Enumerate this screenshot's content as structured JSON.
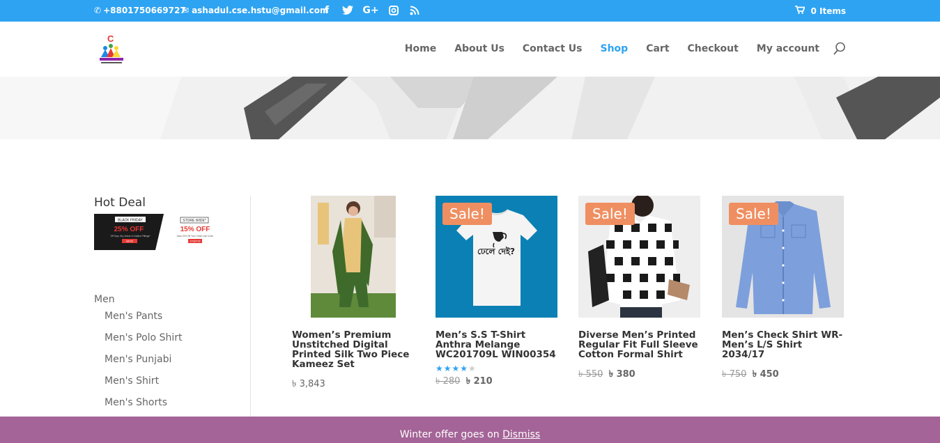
{
  "topbar": {
    "phone": "+8801750669727",
    "email": "ashadul.cse.hstu@gmail.com",
    "social": [
      "f",
      "t",
      "G+",
      "ig",
      "rss"
    ],
    "cart": "0 Items"
  },
  "nav": {
    "items": [
      "Home",
      "About Us",
      "Contact Us",
      "Shop",
      "Cart",
      "Checkout",
      "My account"
    ],
    "active": "Shop"
  },
  "sidebar": {
    "hot_deal_title": "Hot Deal",
    "deal": {
      "left_tag": "BLACK FRIDAY",
      "left_percent": "25% OFF",
      "left_note": "Off Tops, Dry, Indoor & Outdoor Fittings*",
      "left_code": "BF25",
      "right_tag": "STORE WIDE*",
      "right_percent": "15% OFF",
      "right_note": "Save 15% Off Your Order! Use Code:",
      "right_code": "XTEP15"
    },
    "category_title": "Men",
    "categories": [
      "Men's Pants",
      "Men's Polo Shirt",
      "Men's Punjabi",
      "Men's Shirt",
      "Men's Shorts"
    ]
  },
  "products": [
    {
      "title": "Women’s Premium Unstitched Digital Printed Silk Two Piece Kameez Set",
      "price": "৳ 3,843",
      "sale": false
    },
    {
      "title": "Men’s S.S T-Shirt Anthra Melange WC201709L WIN00354",
      "sale_label": "Sale!",
      "sale": true,
      "old_price": "৳ 280",
      "new_price": "৳ 210",
      "rating": 4.2,
      "tshirt_text": "ঢেলে দেই?"
    },
    {
      "title": "Diverse Men’s Printed Regular Fit Full Sleeve Cotton Formal Shirt",
      "sale_label": "Sale!",
      "sale": true,
      "old_price": "৳ 550",
      "new_price": "৳ 380"
    },
    {
      "title": "Men’s Check Shirt WR-Men’s L/S Shirt 2034/17",
      "sale_label": "Sale!",
      "sale": true,
      "old_price": "৳ 750",
      "new_price": "৳ 450"
    }
  ],
  "notice": {
    "text": "Winter offer goes on ",
    "dismiss": "Dismiss"
  },
  "colors": {
    "topbar": "#2ea3f2",
    "accent": "#2ea3f2",
    "sale_badge": "#ef8f61",
    "notice_bar": "#a46497"
  }
}
